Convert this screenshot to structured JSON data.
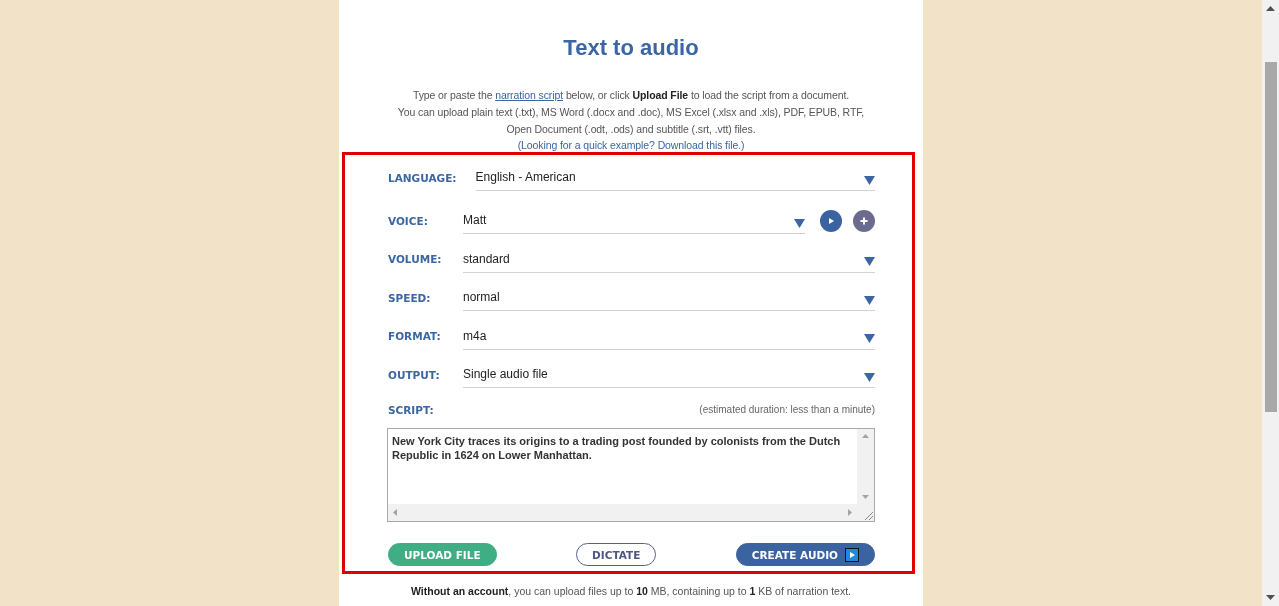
{
  "page": {
    "title": "Text to audio"
  },
  "intro": {
    "text_before_link": "Type or paste the ",
    "link": "narration script",
    "text_after_link": " below, or click **Upload File** to load the script from a document.\nYou can upload plain text (.txt), MS Word (.docx and .doc), MS Excel (.xlsx and .xls), PDF, EPUB, RTF,\nOpen Document (.odt, .ods) and subtitle (.srt, .vtt) files.",
    "example": "(Looking for a quick example? Download this file.)"
  },
  "form": {
    "highlighted": true,
    "fields": [
      {
        "kind": "select",
        "label": "LANGUAGE:",
        "value": "English - American"
      },
      {
        "kind": "select_with_preview",
        "label": "VOICE:",
        "value": "Matt"
      },
      {
        "kind": "select",
        "label": "VOLUME:",
        "value": "standard"
      },
      {
        "kind": "select",
        "label": "SPEED:",
        "value": "normal"
      },
      {
        "kind": "select",
        "label": "FORMAT:",
        "value": "m4a"
      },
      {
        "kind": "select",
        "label": "OUTPUT:",
        "value": "Single audio file"
      }
    ],
    "script": {
      "label": "SCRIPT:",
      "note": "(estimated duration: less than a minute)",
      "value": "New York City traces its origins to a trading post founded by colonists from the Dutch Republic in 1624 on Lower Manhattan."
    },
    "buttons": [
      {
        "kind": "upload",
        "label": "UPLOAD FILE"
      },
      {
        "kind": "dictate",
        "label": "DICTATE"
      },
      {
        "kind": "create",
        "label": "CREATE AUDIO"
      }
    ]
  },
  "account_note": "**Without an account**, you can upload files up to **10** MB, containing up to **1** KB of narration text."
}
